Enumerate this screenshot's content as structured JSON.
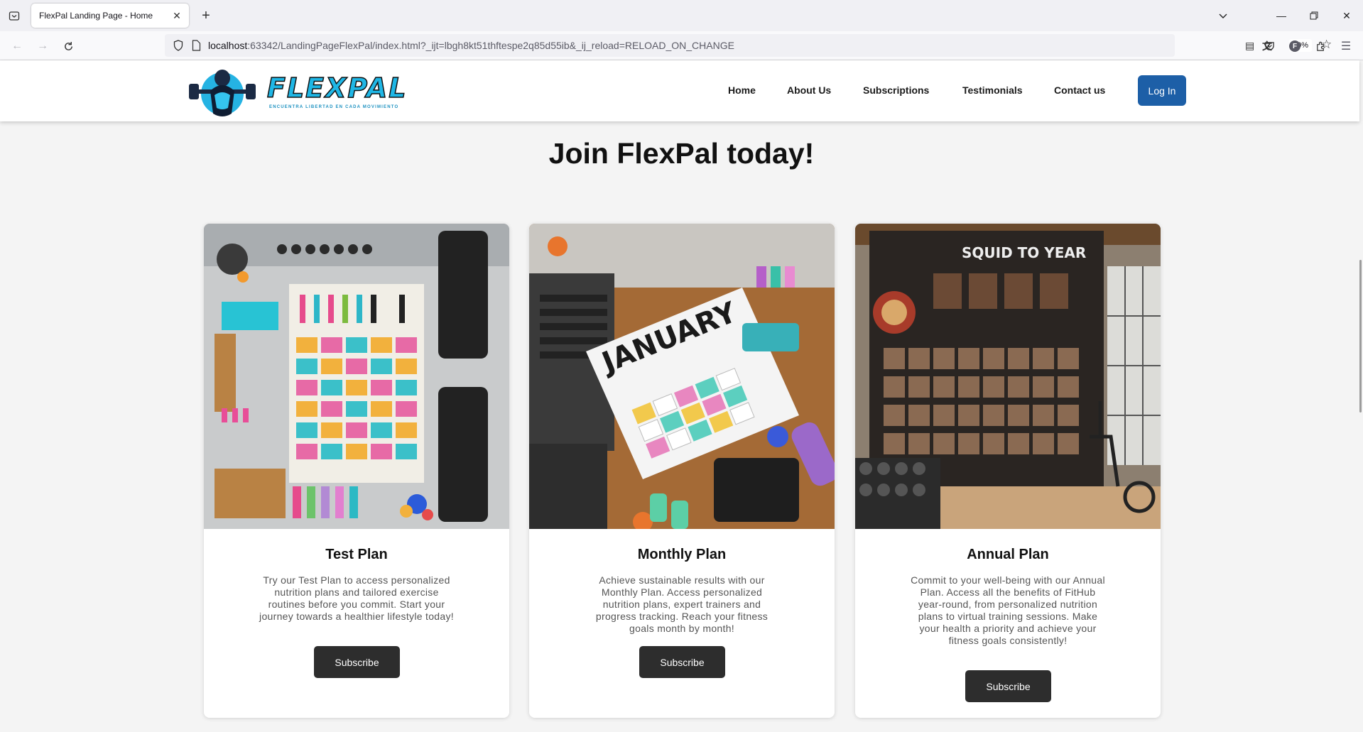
{
  "browser": {
    "tab_title": "FlexPal Landing Page - Home",
    "url_host": "localhost",
    "url_rest": ":63342/LandingPageFlexPal/index.html?_ijt=lbgh8kt51thftespe2q85d55ib&_ij_reload=RELOAD_ON_CHANGE",
    "zoom": "90%",
    "account_initial": "F"
  },
  "site": {
    "logo_text": "FLEXPAL",
    "logo_tagline": "ENCUENTRA LIBERTAD EN CADA MOVIMIENTO",
    "nav": [
      "Home",
      "About Us",
      "Subscriptions",
      "Testimonials",
      "Contact us"
    ],
    "login_label": "Log In"
  },
  "hero": {
    "title": "Join FlexPal today!"
  },
  "plans": [
    {
      "title": "Test Plan",
      "description": "Try our Test Plan to access personalized nutrition plans and tailored exercise routines before you commit. Start your journey towards a healthier lifestyle today!",
      "button": "Subscribe",
      "image_label": ""
    },
    {
      "title": "Monthly Plan",
      "description": "Achieve sustainable results with our Monthly Plan. Access personalized nutrition plans, expert trainers and progress tracking. Reach your fitness goals month by month!",
      "button": "Subscribe",
      "image_label": "JANUARY"
    },
    {
      "title": "Annual Plan",
      "description": "Commit to your well-being with our Annual Plan. Access all the benefits of FitHub year-round, from personalized nutrition plans to virtual training sessions. Make your health a priority and achieve your fitness goals consistently!",
      "button": "Subscribe",
      "image_label": "SQUID TO YEAR"
    }
  ],
  "colors": {
    "login": "#1d5fa7",
    "subscribe": "#2d2d2d",
    "logo_accent": "#1fb7e6"
  }
}
